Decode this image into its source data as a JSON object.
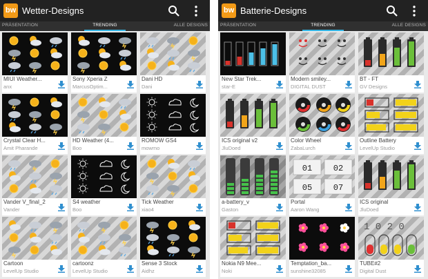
{
  "panels": [
    {
      "title": "Wetter-Designs",
      "logo_text": "bw",
      "tabs": [
        "PRÄSENTATION",
        "TRENDING",
        "ALLE DESIGNS"
      ],
      "active_tab": 1,
      "items": [
        {
          "name": "MIUI Weather...",
          "author": "anx",
          "style": "dark",
          "icon": "weather-sun-cloud-icons"
        },
        {
          "name": "Sony Xperia Z",
          "author": "MarcusOptim...",
          "style": "dark",
          "icon": "weather-sun-cloud-icons"
        },
        {
          "name": "Dani HD",
          "author": "Dani",
          "style": "striped",
          "icon": "weather-sun-cloud-icons"
        },
        {
          "name": "Crystal Clear H...",
          "author": "Amit Pharande",
          "style": "dark",
          "icon": "weather-sun-cloud-icons"
        },
        {
          "name": "HD Weather (4...",
          "author": "Boo",
          "style": "striped",
          "icon": "weather-sun-cloud-icons"
        },
        {
          "name": "ROMOW GS4",
          "author": "mowmo",
          "style": "dark",
          "icon": "weather-line-icons"
        },
        {
          "name": "Vander V_final_2",
          "author": "Vander",
          "style": "striped",
          "icon": "weather-sun-cloud-icons"
        },
        {
          "name": "S4 weather",
          "author": "Boo",
          "style": "dark",
          "icon": "weather-line-icons"
        },
        {
          "name": "Tick Weather",
          "author": "xiao4",
          "style": "striped",
          "icon": "weather-sun-cloud-icons"
        },
        {
          "name": "Cartoon",
          "author": "LevelUp Studio",
          "style": "striped",
          "icon": "weather-sun-cloud-icons"
        },
        {
          "name": "cartoonz",
          "author": "LevelUp Studio",
          "style": "striped",
          "icon": "weather-sun-cloud-icons"
        },
        {
          "name": "Sense 3 Stock",
          "author": "Aidhz",
          "style": "dark",
          "icon": "weather-sun-cloud-icons"
        }
      ]
    },
    {
      "title": "Batterie-Designs",
      "logo_text": "bw",
      "tabs": [
        "PRÄSENTATION",
        "TRENDING",
        "ALLE DESIGNS"
      ],
      "active_tab": 1,
      "items": [
        {
          "name": "New Star Trek...",
          "author": "star-E",
          "style": "dark",
          "icon": "battery-bar-icons"
        },
        {
          "name": "Modern smiley...",
          "author": "DIGITAL DUST",
          "style": "striped",
          "icon": "smiley-face-icons"
        },
        {
          "name": "BT - FT",
          "author": "GV Designs",
          "style": "striped",
          "icon": "battery-cell-icons"
        },
        {
          "name": "ICS original v2",
          "author": "JluDoed",
          "style": "striped",
          "icon": "battery-cell-icons"
        },
        {
          "name": "Color Wheel",
          "author": "ZabaLurch",
          "style": "striped",
          "icon": "color-wheel-icons"
        },
        {
          "name": "Outline Battery",
          "author": "LevelUp Studio",
          "style": "striped",
          "icon": "battery-outline-icons"
        },
        {
          "name": "a-battery_v",
          "author": "Gaston",
          "style": "gray",
          "icon": "battery-tube-icons"
        },
        {
          "name": "Portal",
          "author": "Aaron Wang",
          "style": "striped",
          "icon": "digital-counter-icons"
        },
        {
          "name": "ICS original",
          "author": "JluDoed",
          "style": "striped",
          "icon": "battery-cell-icons"
        },
        {
          "name": "Nokia N9 Mee...",
          "author": "Noki",
          "style": "striped",
          "icon": "battery-outline-icons"
        },
        {
          "name": "Temptation_ba...",
          "author": "sunshine32085",
          "style": "dark",
          "icon": "flower-icons"
        },
        {
          "name": "TUBE#2",
          "author": "Digital Dust",
          "style": "striped",
          "icon": "tube-battery-icons"
        }
      ]
    }
  ]
}
